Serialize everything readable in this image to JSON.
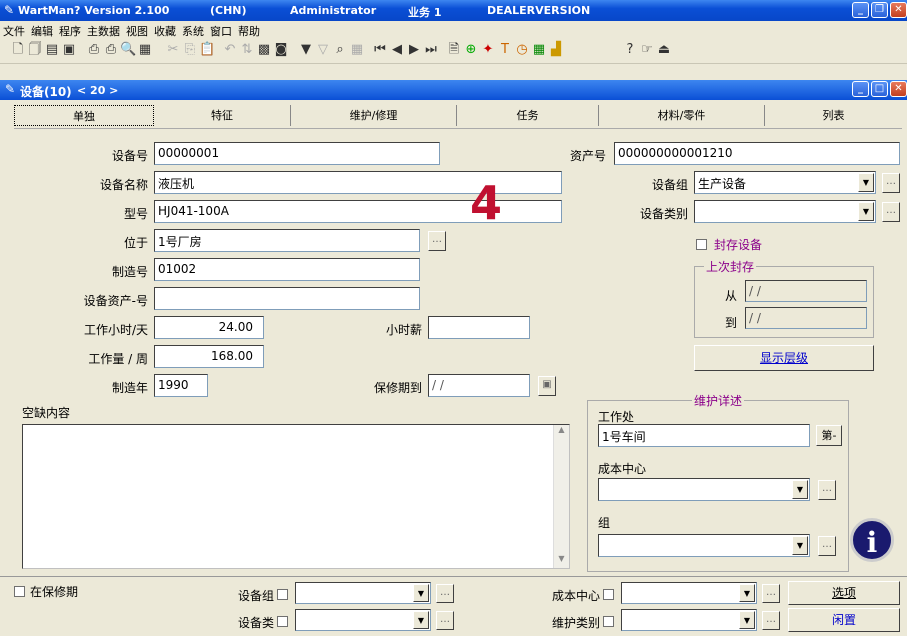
{
  "app": {
    "title": "WartMan? Version 2.100",
    "lang": "(CHN)",
    "user": "Administrator",
    "business": "业务 1",
    "edition": "DEALERVERSION"
  },
  "menu": [
    "文件",
    "编辑",
    "程序",
    "主数据",
    "视图",
    "收藏",
    "系统",
    "窗口",
    "帮助"
  ],
  "window": {
    "title": "设备(10)",
    "counter": "< 20 >"
  },
  "tabs": [
    "单独",
    "特征",
    "维护/修理",
    "任务",
    "材料/零件",
    "列表"
  ],
  "form": {
    "equip_no_label": "设备号",
    "equip_no": "00000001",
    "asset_no_label": "资产号",
    "asset_no": "000000000001210",
    "equip_name_label": "设备名称",
    "equip_name": "液压机",
    "equip_group_label": "设备组",
    "equip_group": "生产设备",
    "model_label": "型号",
    "model": "HJ041-100A",
    "equip_type_label": "设备类别",
    "equip_type": "",
    "location_label": "位于",
    "location": "1号厂房",
    "mfg_no_label": "制造号",
    "mfg_no": "01002",
    "equip_asset_label": "设备资产-号",
    "equip_asset": "",
    "work_hours_label": "工作小时/天",
    "work_hours": "24.00",
    "hourly_wage_label": "小时薪",
    "hourly_wage": "",
    "workload_label": "工作量 / 周",
    "workload": "168.00",
    "mfg_year_label": "制造年",
    "mfg_year": "1990",
    "warranty_label": "保修期到",
    "warranty": " / /",
    "vacancy_label": "空缺内容",
    "big_number": "4"
  },
  "seal": {
    "checkbox_label": "封存设备",
    "group_title": "上次封存",
    "from_label": "从",
    "from": " / /",
    "to_label": "到",
    "to": " / /",
    "show_level": "显示层级"
  },
  "maint": {
    "group_title": "维护详述",
    "workplace_label": "工作处",
    "workplace": "1号车间",
    "workplace_btn": "第-",
    "cost_center_label": "成本中心",
    "cost_center": "",
    "group_label": "组",
    "group": ""
  },
  "bottom": {
    "warranty_label": "在保修期",
    "equip_group_label": "设备组",
    "cost_center_label": "成本中心",
    "options_btn": "选项",
    "equip_type_label": "设备类",
    "maint_type_label": "维护类别",
    "idle_btn": "闲置"
  }
}
